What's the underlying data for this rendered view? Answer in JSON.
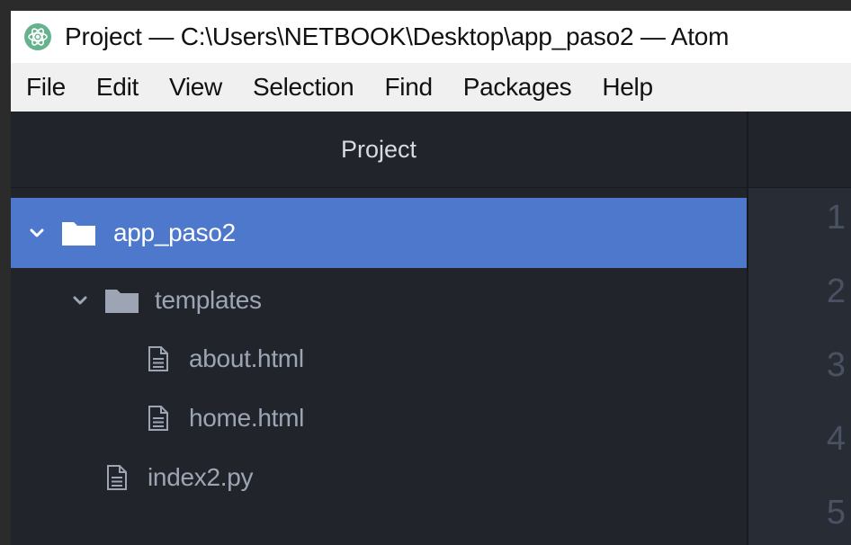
{
  "window": {
    "title": "Project — C:\\Users\\NETBOOK\\Desktop\\app_paso2 — Atom",
    "app_icon": "atom-icon"
  },
  "menu": {
    "items": [
      "File",
      "Edit",
      "View",
      "Selection",
      "Find",
      "Packages",
      "Help"
    ]
  },
  "tree_view": {
    "header": "Project",
    "root": {
      "label": "app_paso2",
      "expanded": true,
      "selected": true
    },
    "templates": {
      "label": "templates",
      "expanded": true
    },
    "files": [
      "about.html",
      "home.html",
      "index2.py"
    ]
  },
  "editor": {
    "line_numbers": [
      "1",
      "2",
      "3",
      "4",
      "5"
    ]
  },
  "colors": {
    "selection": "#4d78cc",
    "panel_bg": "#21252b",
    "editor_bg": "#282c34",
    "text": "#9da5b4"
  }
}
